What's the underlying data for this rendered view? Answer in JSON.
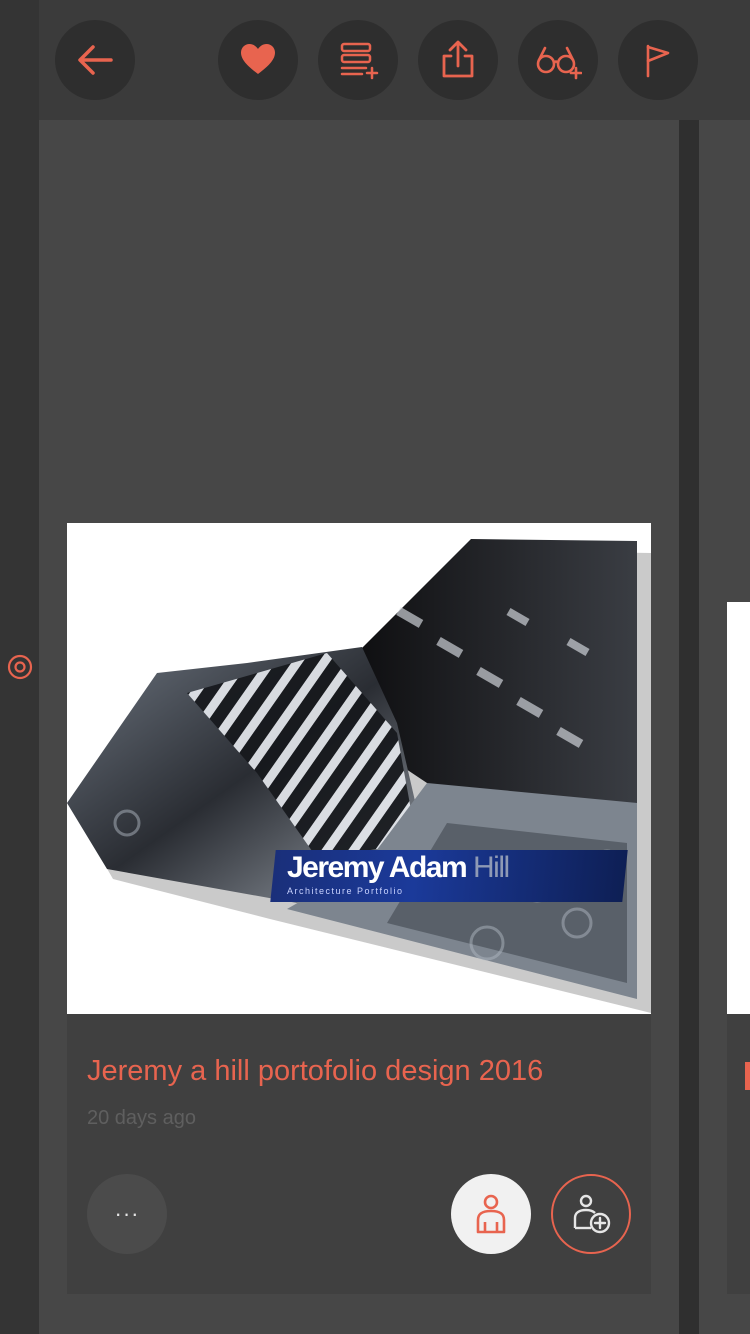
{
  "theme": {
    "accent": "#e8644f",
    "background": "#474747",
    "button_bg": "#2e2e2e"
  },
  "toolbar": {
    "back": "arrow-left-icon",
    "like": "heart-icon",
    "add_to_collection": "add-to-list-icon",
    "share": "share-icon",
    "watch": "glasses-plus-icon",
    "report": "flag-icon"
  },
  "side_rail": {
    "icon": "target-icon"
  },
  "project": {
    "cover": {
      "name_bold": "Jeremy Adam",
      "name_light": "Hill",
      "subtitle": "Architecture Portfolio"
    },
    "title": "Jeremy a hill portofolio design 2016",
    "time": "20 days ago",
    "more_label": "···",
    "author_icon": "person-icon",
    "follow_icon": "person-add-icon"
  }
}
